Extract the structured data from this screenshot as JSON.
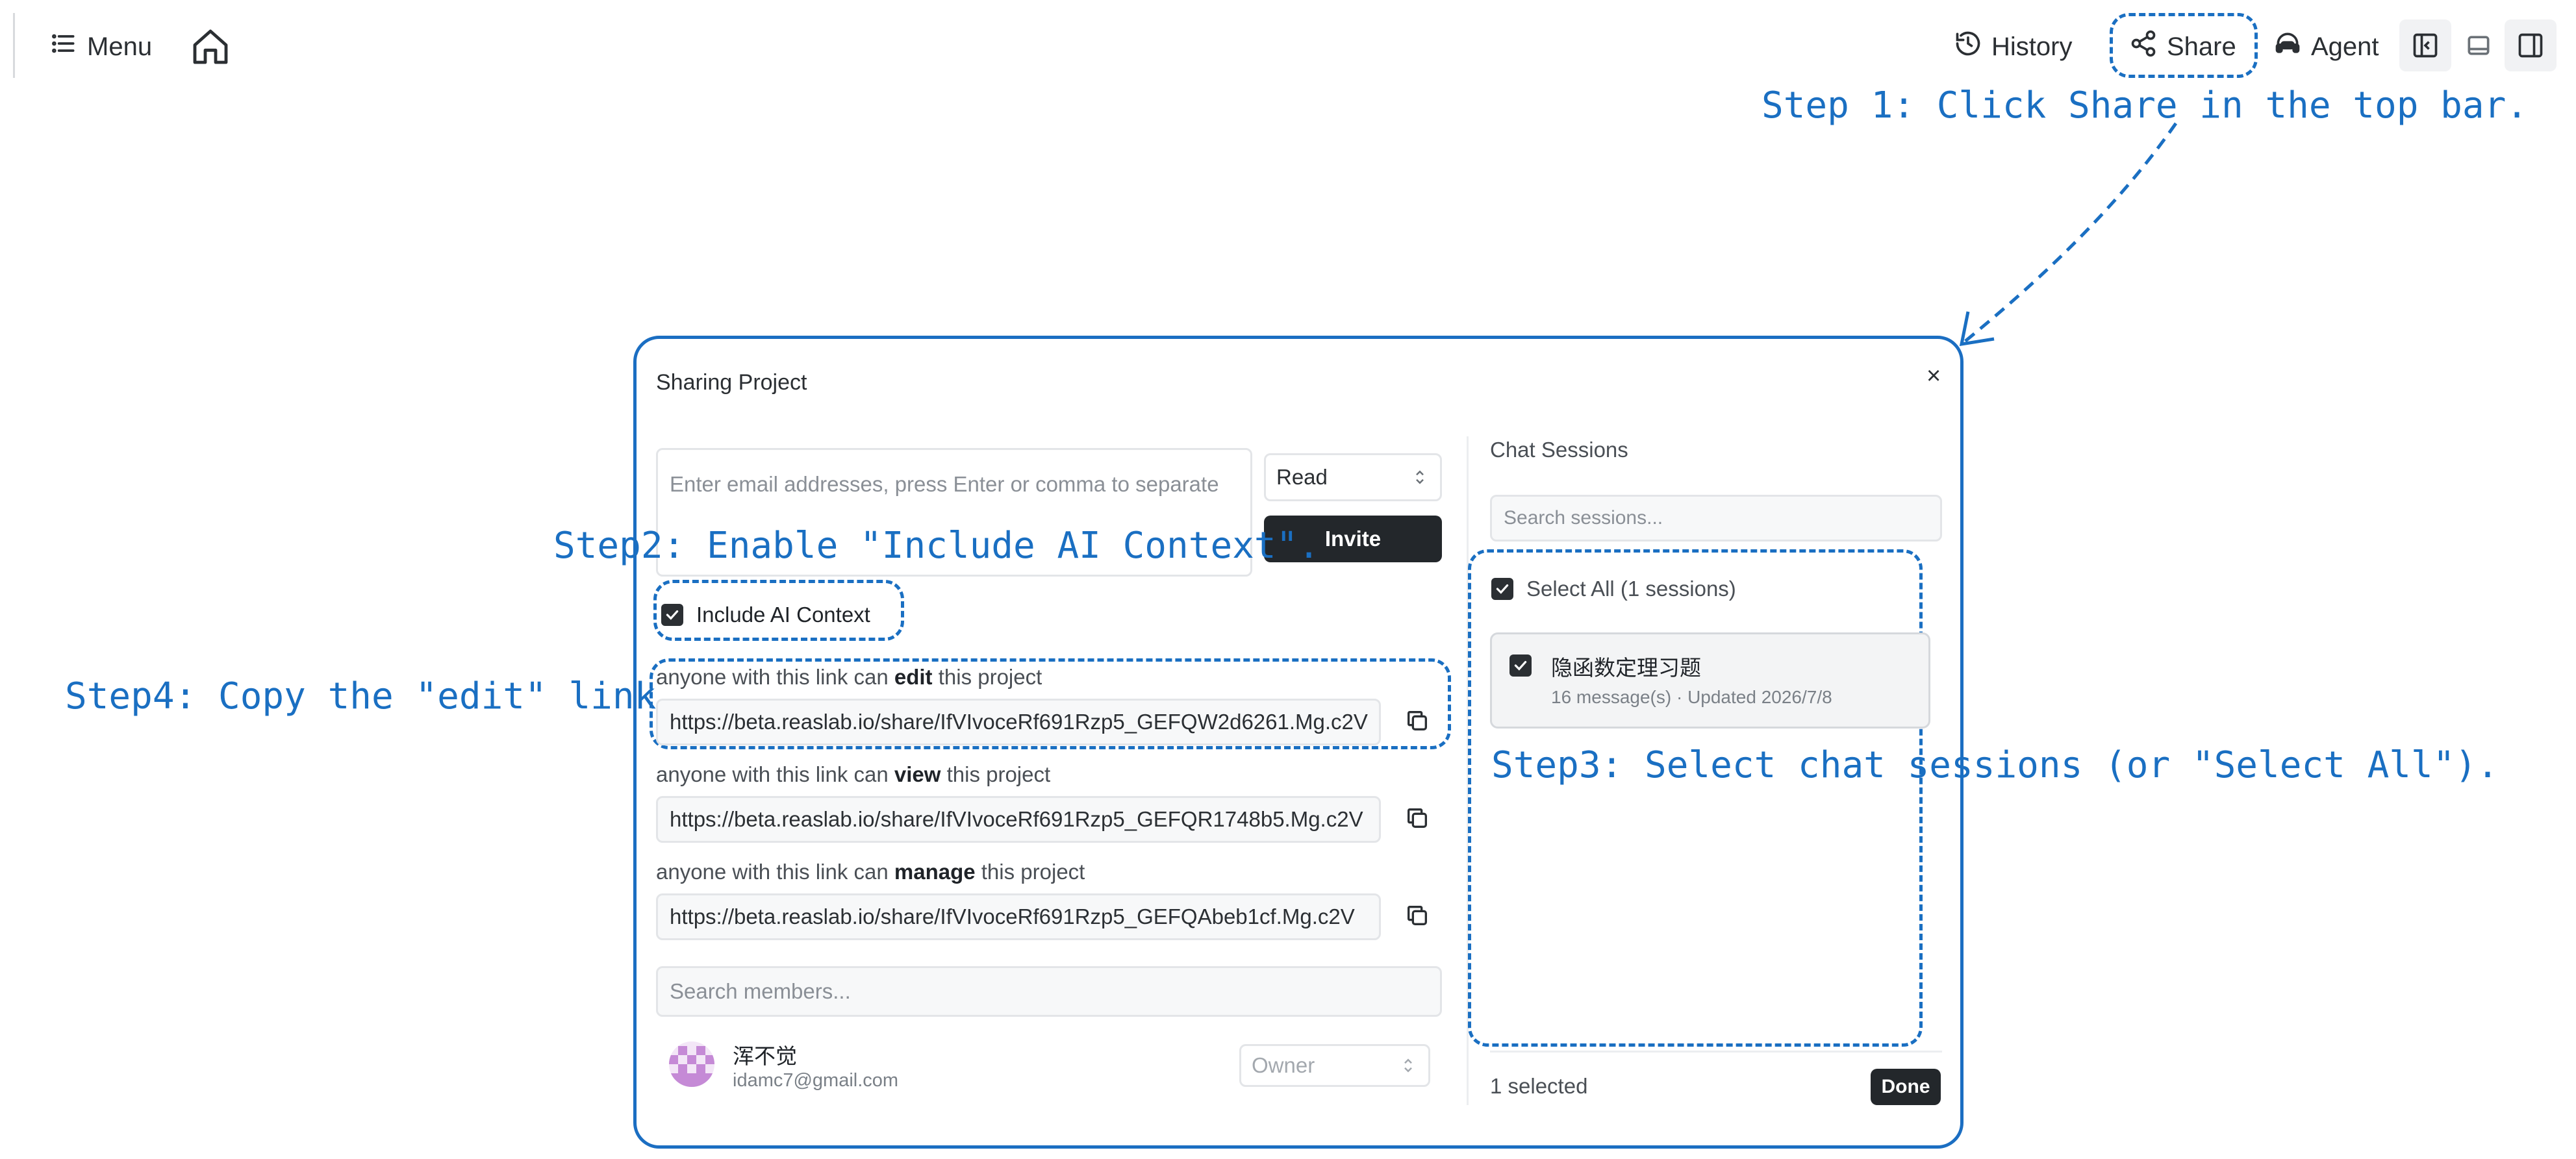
{
  "topbar": {
    "menu_label": "Menu",
    "history_label": "History",
    "share_label": "Share",
    "agent_label": "Agent"
  },
  "annotations": {
    "step1": "Step 1: Click Share in the top bar.",
    "step2": "Step2: Enable \"Include AI Context\".",
    "step3": "Step3: Select chat sessions (or \"Select All\").",
    "step4": "Step4: Copy the \"edit\" link."
  },
  "modal": {
    "title": "Sharing Project",
    "close": "×",
    "email_placeholder": "Enter email addresses, press Enter or comma to separate",
    "permission_select": "Read",
    "invite_label": "Invite",
    "include_ai_context_label": "Include AI Context",
    "links": [
      {
        "prefix": "anyone with this link can",
        "perm": "edit",
        "suffix": "this project",
        "url": "https://beta.reaslab.io/share/IfVIvoceRf691Rzp5_GEFQW2d6261.Mg.c2V"
      },
      {
        "prefix": "anyone with this link can",
        "perm": "view",
        "suffix": "this project",
        "url": "https://beta.reaslab.io/share/IfVIvoceRf691Rzp5_GEFQR1748b5.Mg.c2V"
      },
      {
        "prefix": "anyone with this link can",
        "perm": "manage",
        "suffix": "this project",
        "url": "https://beta.reaslab.io/share/IfVIvoceRf691Rzp5_GEFQAbeb1cf.Mg.c2V"
      }
    ],
    "search_members_placeholder": "Search members...",
    "member": {
      "name": "浑不觉",
      "email": "idamc7@gmail.com",
      "role": "Owner"
    },
    "chat_sessions": {
      "title": "Chat Sessions",
      "search_placeholder": "Search sessions...",
      "select_all_label": "Select All (1 sessions)",
      "sessions": [
        {
          "title": "隐函数定理习题",
          "meta": "16 message(s) · Updated 2026/7/8"
        }
      ],
      "selected_count": "1 selected",
      "done_label": "Done"
    }
  },
  "colors": {
    "annotation_blue": "#1a6fc2",
    "dark_button": "#23272b",
    "avatar_purple": "#c58ad6"
  }
}
